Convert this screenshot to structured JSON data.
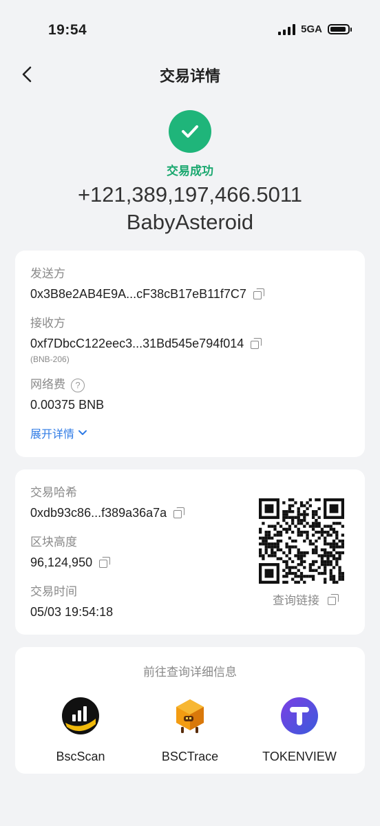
{
  "status_bar": {
    "time": "19:54",
    "network": "5GA"
  },
  "nav": {
    "title": "交易详情"
  },
  "transaction": {
    "status": "交易成功",
    "amount": "+121,389,197,466.5011",
    "token": "BabyAsteroid"
  },
  "details": {
    "sender_label": "发送方",
    "sender": "0x3B8e2AB4E9A...cF38cB17eB11f7C7",
    "receiver_label": "接收方",
    "receiver": "0xf7DbcC122eec3...31Bd545e794f014",
    "receiver_tag": "(BNB-206)",
    "fee_label": "网络费",
    "fee": "0.00375 BNB",
    "expand_label": "展开详情"
  },
  "chain": {
    "hash_label": "交易哈希",
    "hash": "0xdb93c86...f389a36a7a",
    "block_label": "区块高度",
    "block": "96,124,950",
    "time_label": "交易时间",
    "time": "05/03 19:54:18",
    "qr_link_label": "查询链接"
  },
  "explorers": {
    "title": "前往查询详细信息",
    "items": [
      {
        "name": "BscScan"
      },
      {
        "name": "BSCTrace"
      },
      {
        "name": "TOKENVIEW"
      }
    ]
  },
  "colors": {
    "success": "#1fb57a",
    "link": "#2f7be5"
  }
}
